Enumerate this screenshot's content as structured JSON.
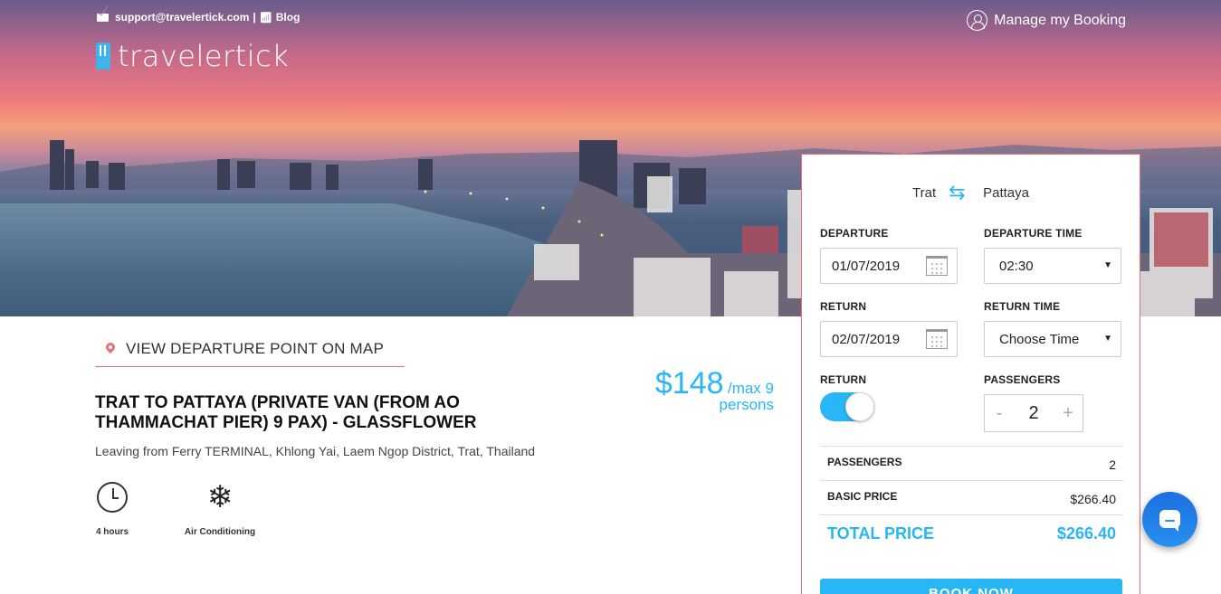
{
  "header": {
    "email": "support@travelertick.com",
    "separator": "|",
    "blog_label": "Blog",
    "logo_text": "travelertick",
    "manage_booking": "Manage my Booking"
  },
  "trip": {
    "map_link": "VIEW DEPARTURE POINT ON MAP",
    "title": "TRAT TO PATTAYA (PRIVATE VAN (FROM AO THAMMACHAT PIER) 9 PAX) - GLASSFLOWER",
    "subtitle": "Leaving from Ferry TERMINAL, Khlong Yai, Laem Ngop District, Trat, Thailand",
    "price": "$148",
    "price_unit_1": "/max 9",
    "price_unit_2": "persons",
    "features": [
      {
        "icon": "clock-icon",
        "label": "4 hours"
      },
      {
        "icon": "snowflake-icon",
        "label": "Air Conditioning"
      }
    ]
  },
  "booking": {
    "from": "Trat",
    "to": "Pattaya",
    "departure_label": "DEPARTURE",
    "departure_value": "01/07/2019",
    "departure_time_label": "DEPARTURE TIME",
    "departure_time_value": "02:30",
    "return_label": "RETURN",
    "return_value": "02/07/2019",
    "return_time_label": "RETURN TIME",
    "return_time_value": "Choose Time",
    "return_toggle_label": "RETURN",
    "return_toggle_on": true,
    "passengers_label": "PASSENGERS",
    "passengers_value": "2",
    "minus": "-",
    "plus": "+",
    "summary": {
      "passengers_label": "PASSENGERS",
      "passengers_value": "2",
      "basic_price_label": "BASIC PRICE",
      "basic_price_value": "$266.40",
      "total_label": "TOTAL PRICE",
      "total_value": "$266.40"
    },
    "book_button": "BOOK NOW"
  },
  "colors": {
    "accent": "#29b6f6",
    "border": "#e57373",
    "chat": "#1d6fe0"
  }
}
